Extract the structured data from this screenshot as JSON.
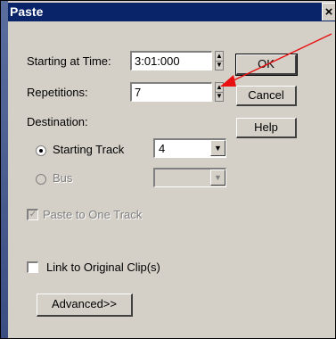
{
  "dialog": {
    "title": "Paste",
    "close_glyph": "✕"
  },
  "start_time": {
    "label": "Starting at Time:",
    "value": "3:01:000"
  },
  "repetitions": {
    "label": "Repetitions:",
    "value": "7"
  },
  "destination": {
    "label": "Destination:",
    "starting_track": {
      "label": "Starting Track",
      "selected": true,
      "value": "4"
    },
    "bus": {
      "label": "Bus",
      "selected": false,
      "value": ""
    }
  },
  "paste_to_one_track": {
    "label": "Paste to One Track",
    "checked": true
  },
  "link_to_original": {
    "label": "Link to Original Clip(s)",
    "checked": false
  },
  "buttons": {
    "ok": "OK",
    "cancel": "Cancel",
    "help": "Help",
    "advanced": "Advanced>>"
  },
  "annotation": {
    "color": "#e81010"
  }
}
